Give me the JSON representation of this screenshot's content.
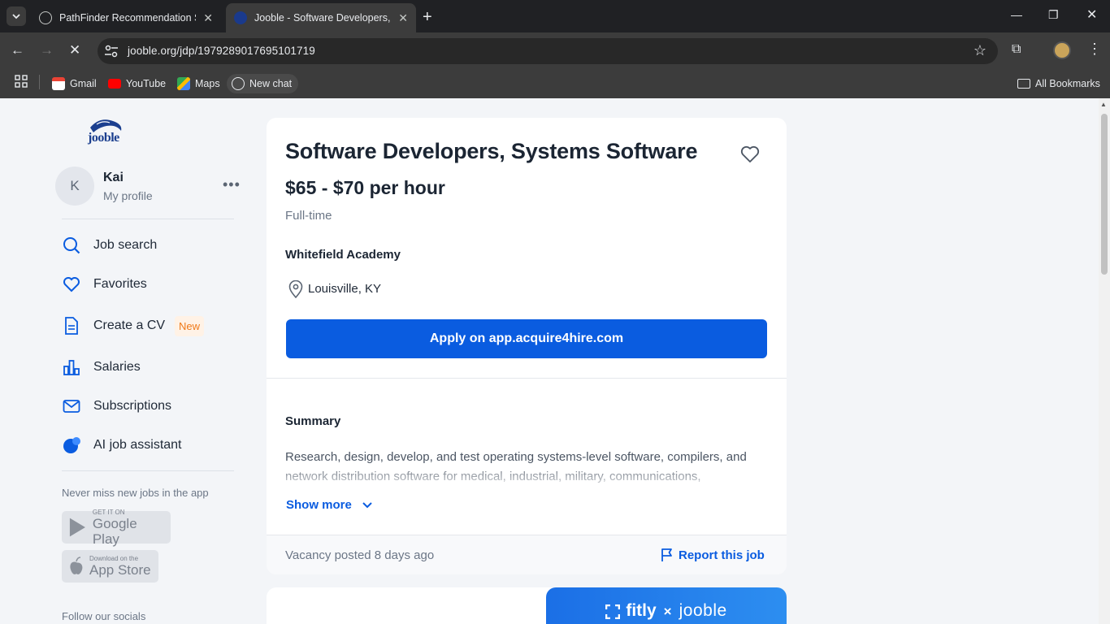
{
  "browser": {
    "tabs": [
      {
        "title": "PathFinder Recommendation Sy",
        "active": false
      },
      {
        "title": "Jooble - Software Developers, S",
        "active": true
      }
    ],
    "url": "jooble.org/jdp/1979289017695101719",
    "bookmarks": [
      {
        "label": "Gmail",
        "icon": "gmail-icon"
      },
      {
        "label": "YouTube",
        "icon": "youtube-icon"
      },
      {
        "label": "Maps",
        "icon": "maps-icon"
      },
      {
        "label": "New chat",
        "icon": "openai-icon"
      }
    ],
    "all_bookmarks": "All Bookmarks"
  },
  "sidebar": {
    "brand": "jooble",
    "user": {
      "initial": "K",
      "name": "Kai",
      "profile_link": "My profile"
    },
    "nav": [
      {
        "label": "Job search",
        "icon": "search-icon"
      },
      {
        "label": "Favorites",
        "icon": "heart-icon"
      },
      {
        "label": "Create a CV",
        "icon": "document-icon",
        "badge": "New"
      },
      {
        "label": "Salaries",
        "icon": "bar-chart-icon"
      },
      {
        "label": "Subscriptions",
        "icon": "mail-icon"
      },
      {
        "label": "AI job assistant",
        "icon": "ai-assistant-icon"
      }
    ],
    "promo": "Never miss new jobs in the app",
    "google_play": {
      "small": "GET IT ON",
      "big": "Google Play"
    },
    "app_store": {
      "small": "Download on the",
      "big": "App Store"
    },
    "follow": "Follow our socials"
  },
  "job": {
    "title": "Software Developers, Systems Software",
    "salary": "$65 - $70 per hour",
    "type": "Full-time",
    "company": "Whitefield Academy",
    "location": "Louisville, KY",
    "apply_label": "Apply on app.acquire4hire.com",
    "summary_title": "Summary",
    "summary_text": "Research, design, develop, and test operating systems-level software, compilers, and network distribution software for medical, industrial, military, communications,",
    "show_more": "Show more",
    "posted": "Vacancy posted 8 days ago",
    "report": "Report this job"
  },
  "banner": {
    "left": "fitly",
    "sep": "×",
    "right": "jooble"
  },
  "colors": {
    "accent": "#0a5ce0",
    "page_bg": "#f3f5f8",
    "badge_bg": "#fff2e6",
    "badge_text": "#ef7a1a"
  }
}
